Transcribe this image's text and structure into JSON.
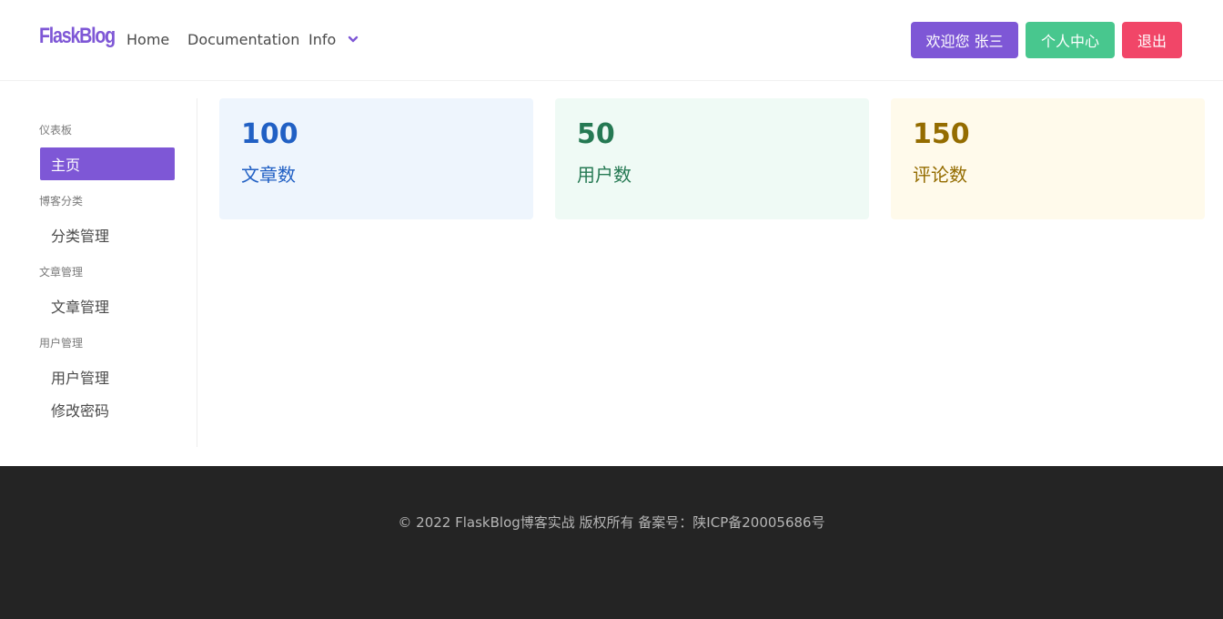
{
  "navbar": {
    "brand": "FlaskBlog",
    "links": {
      "home": "Home",
      "documentation": "Documentation",
      "info": "Info"
    },
    "buttons": {
      "welcome": "欢迎您 张三",
      "profile": "个人中心",
      "logout": "退出"
    }
  },
  "sidebar": {
    "sections": [
      {
        "label": "仪表板",
        "items": [
          "主页"
        ]
      },
      {
        "label": "博客分类",
        "items": [
          "分类管理"
        ]
      },
      {
        "label": "文章管理",
        "items": [
          "文章管理"
        ]
      },
      {
        "label": "用户管理",
        "items": [
          "用户管理",
          "修改密码"
        ]
      }
    ],
    "active_item": "主页"
  },
  "stats": {
    "articles": {
      "value": "100",
      "label": "文章数"
    },
    "users": {
      "value": "50",
      "label": "用户数"
    },
    "comments": {
      "value": "150",
      "label": "评论数"
    }
  },
  "footer": {
    "text": "© 2022 FlaskBlog博客实战 版权所有 备案号：陕ICP备20005686号"
  },
  "colors": {
    "primary": "#7e57d6",
    "success": "#48c78e",
    "danger": "#f14668",
    "footer_bg": "#242424"
  },
  "icons": {
    "info_dropdown": "chevron-down-icon"
  }
}
